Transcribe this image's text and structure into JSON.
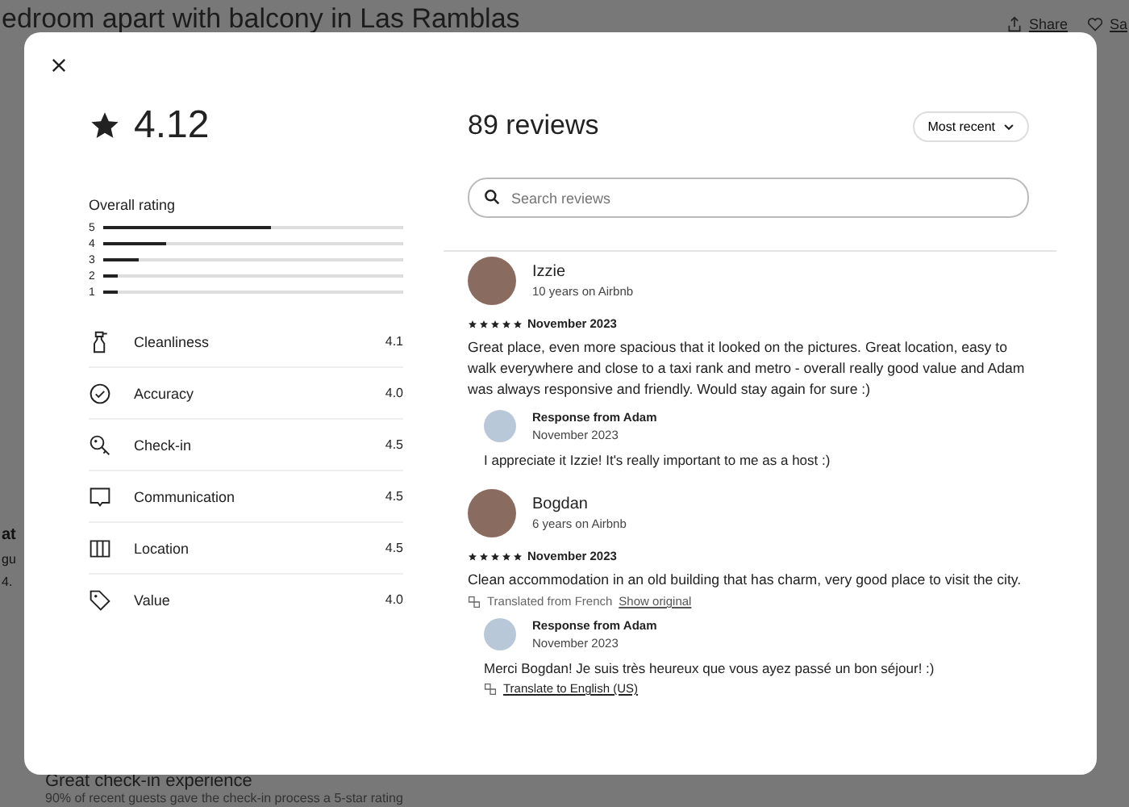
{
  "background": {
    "title": "edroom apart with balcony in Las Ramblas",
    "actions": [
      {
        "label": "Share"
      },
      {
        "label": "Sa"
      }
    ],
    "fragments": [
      "at",
      "gu",
      "4."
    ],
    "highlight": {
      "title": "Great check-in experience",
      "text": "90% of recent guests gave the check-in process a 5-star rating"
    }
  },
  "modal": {
    "rating": "4.12",
    "overall": {
      "title": "Overall rating",
      "bars": [
        {
          "label": "5",
          "level": 0.56
        },
        {
          "label": "4",
          "level": 0.21
        },
        {
          "label": "3",
          "level": 0.12
        },
        {
          "label": "2",
          "level": 0.05
        },
        {
          "label": "1",
          "level": 0.05
        }
      ]
    },
    "categories": [
      {
        "name": "Cleanliness",
        "score": "4.1"
      },
      {
        "name": "Accuracy",
        "score": "4.0"
      },
      {
        "name": "Check-in",
        "score": "4.5"
      },
      {
        "name": "Communication",
        "score": "4.5"
      },
      {
        "name": "Location",
        "score": "4.5"
      },
      {
        "name": "Value",
        "score": "4.0"
      }
    ],
    "reviews_title": "89 reviews",
    "sort": "Most recent",
    "search": {
      "placeholder": "Search reviews"
    },
    "reviews": [
      {
        "name": "Izzie",
        "tenure": "10 years on Airbnb",
        "stars": 5,
        "date": "November 2023",
        "text": "Great place, even more spacious that it looked on the pictures. Great location, easy to walk everywhere and close to a taxi rank and metro - overall really good value and Adam was always responsive and friendly. Would stay again for sure :)",
        "response": {
          "title": "Response from Adam",
          "date": "November 2023",
          "text": "I appreciate it Izzie! It's really important to me as a host :)"
        }
      },
      {
        "name": "Bogdan",
        "tenure": "6 years on Airbnb",
        "stars": 5,
        "date": "November 2023",
        "text": "Clean accommodation in an old building that has charm, very good place to visit the city.",
        "translation": {
          "note": "Translated from French",
          "link": "Show original"
        },
        "response": {
          "title": "Response from Adam",
          "date": "November 2023",
          "text": "Merci Bogdan! Je suis très heureux que vous ayez passé un bon séjour! :)",
          "translate_link": "Translate to English (US)"
        }
      }
    ]
  }
}
